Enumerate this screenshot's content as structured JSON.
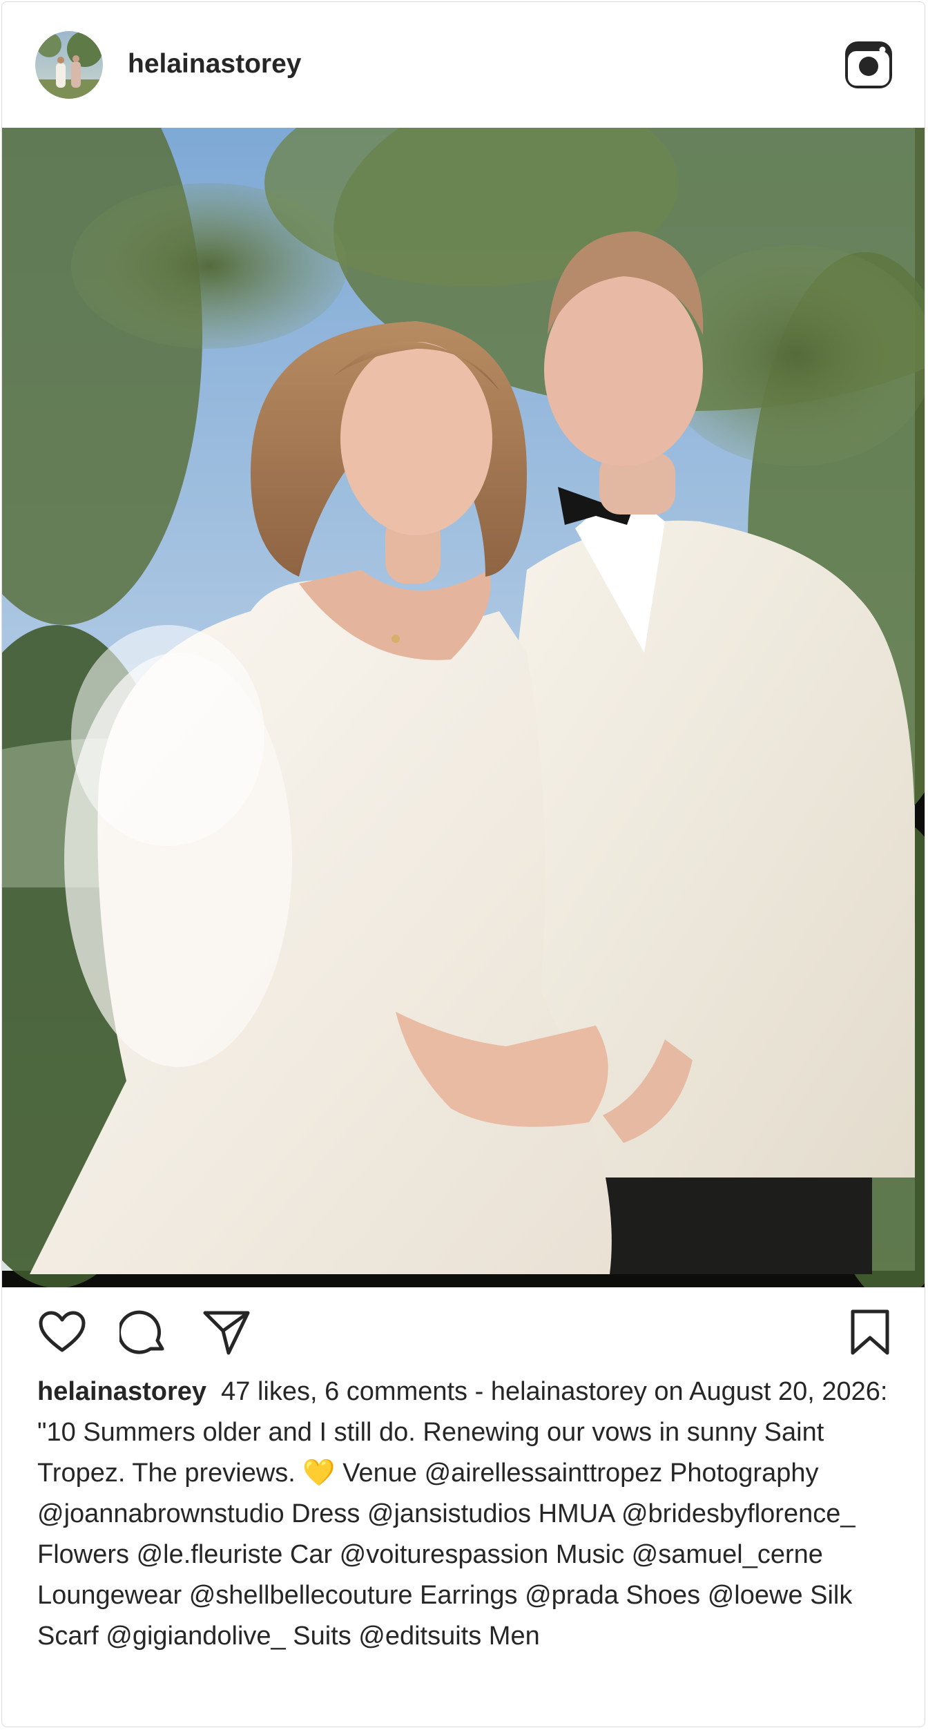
{
  "post": {
    "username": "helainastorey",
    "caption_prefix_user": "helainastorey",
    "caption_text": "47 likes, 6 comments - helainastorey on August 20, 2026: \"10 Summers older and I still do. Renewing our vows in sunny Saint Tropez. The previews. 💛 Venue @airellessainttropez Photography @joannabrownstudio Dress @jansistudios HMUA @bridesbyflorence_ Flowers @le.fleuriste Car @voiturespassion Music @samuel_cerne Loungewear @shellbellecouture Earrings @prada Shoes @loewe Silk Scarf @gigiandolive_ Suits @editsuits Men"
  },
  "icons": {
    "header_logo": "instagram-glyph-icon",
    "like": "heart-icon",
    "comment": "comment-bubble-icon",
    "share": "paper-plane-icon",
    "save": "bookmark-icon"
  },
  "colors": {
    "text": "#262626",
    "border": "#dbdbdb",
    "icon": "#262626"
  }
}
